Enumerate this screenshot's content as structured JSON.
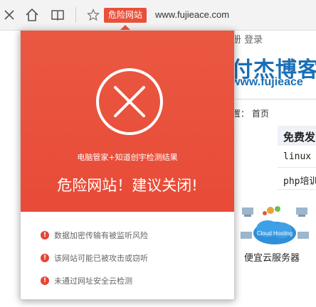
{
  "toolbar": {
    "warning_badge": "危险网站",
    "url": "www.fujieace.com"
  },
  "background_page": {
    "login_links": "册  登录",
    "logo_text": "付杰博客",
    "logo_url": "www.fujieace",
    "breadcrumb": "置：  首页",
    "section_title": "免费发",
    "list_items": [
      "linux",
      "php培训"
    ],
    "cloud_label": "便宜云服务器",
    "cloud_badge": "Cloud Hosting"
  },
  "popup": {
    "source_line": "电脑管家+知道创宇检测结果",
    "headline": "危险网站！建议关闭!",
    "risks": [
      "数据加密传输有被监听风险",
      "该网站可能已被攻击或窃听",
      "未通过网址安全云检测"
    ],
    "accent_color": "#e8503a"
  }
}
